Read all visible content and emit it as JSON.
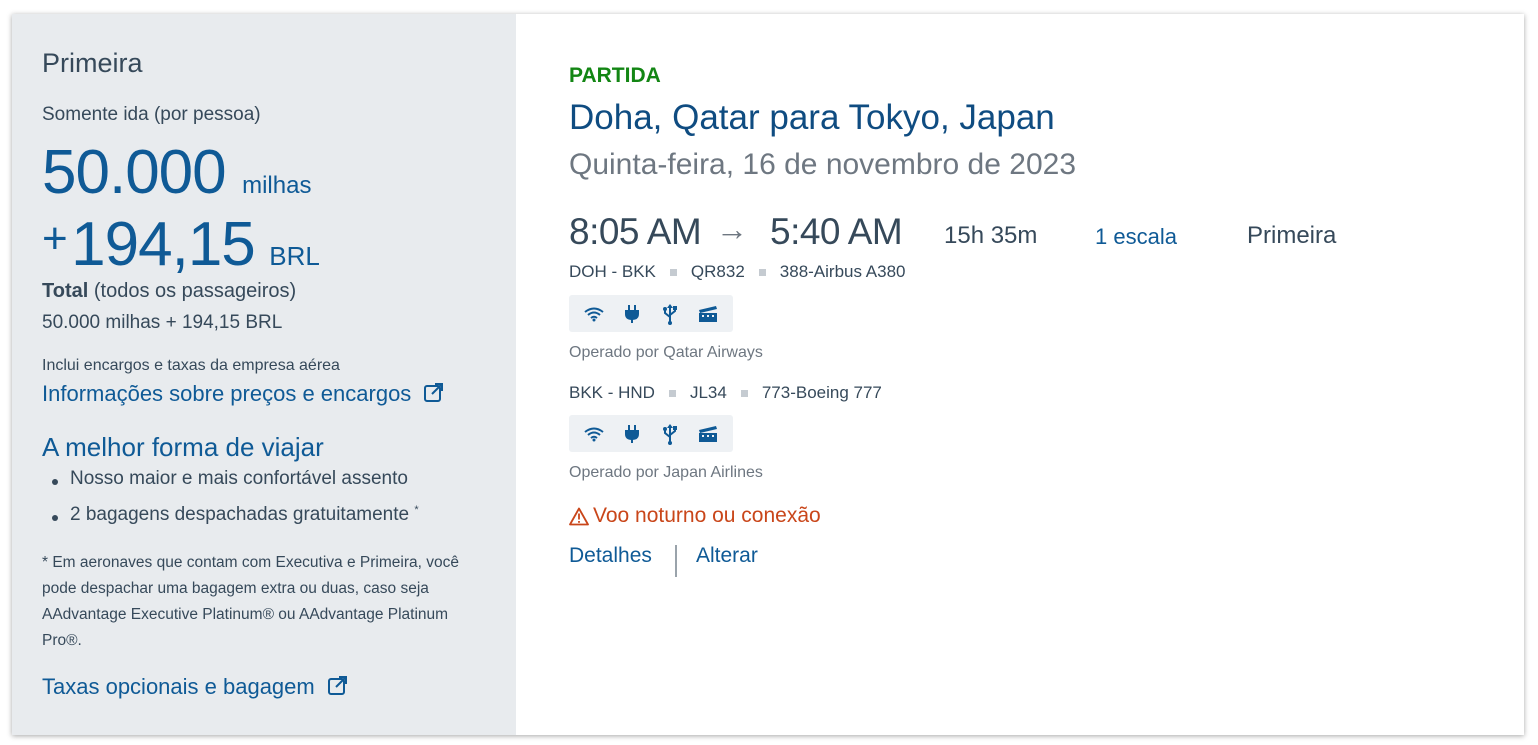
{
  "fare": {
    "cabin": "Primeira",
    "trip_type": "Somente ida (por pessoa)",
    "miles_value": "50.000",
    "miles_unit": "milhas",
    "cash_prefix": "+",
    "cash_value": "194,15",
    "cash_unit": "BRL",
    "total_label": "Total",
    "total_qualifier": "(todos os passageiros)",
    "total_value": "50.000 milhas + 194,15 BRL",
    "includes_text": "Inclui encargos e taxas da empresa aérea",
    "pricing_link": "Informações sobre preços e encargos",
    "benefits_title": "A melhor forma de viajar",
    "benefits": [
      "Nosso maior e mais confortável assento",
      "2 bagagens despachadas gratuitamente"
    ],
    "benefit_footnote_mark": "*",
    "footnote": "* Em aeronaves que contam com Executiva e Primeira, você pode despachar uma bagagem extra ou duas, caso seja AAdvantage Executive Platinum® ou AAdvantage Platinum Pro®.",
    "optional_fees_link": "Taxas opcionais e bagagem"
  },
  "flight": {
    "direction": "PARTIDA",
    "route": "Doha, Qatar para Tokyo, Japan",
    "date": "Quinta-feira, 16 de novembro de 2023",
    "depart_time": "8:05 AM",
    "arrow": "→",
    "arrive_time": "5:40 AM",
    "duration": "15h 35m",
    "stops": "1 escala",
    "cabin": "Primeira",
    "segments": [
      {
        "route": "DOH - BKK",
        "flight_number": "QR832",
        "aircraft": "388-Airbus A380",
        "amenities": [
          "wifi-icon",
          "power-icon",
          "usb-icon",
          "entertainment-icon"
        ],
        "operated_by": "Operado por Qatar Airways"
      },
      {
        "route": "BKK - HND",
        "flight_number": "JL34",
        "aircraft": "773-Boeing 777",
        "amenities": [
          "wifi-icon",
          "power-icon",
          "usb-icon",
          "entertainment-icon"
        ],
        "operated_by": "Operado por Japan Airlines"
      }
    ],
    "warning": "Voo noturno ou conexão",
    "details_link": "Detalhes",
    "change_link": "Alterar"
  },
  "colors": {
    "brand_blue": "#0f5a96",
    "departure_green": "#138614",
    "warning_orange": "#c9461a",
    "panel_gray": "#e8ebee"
  }
}
